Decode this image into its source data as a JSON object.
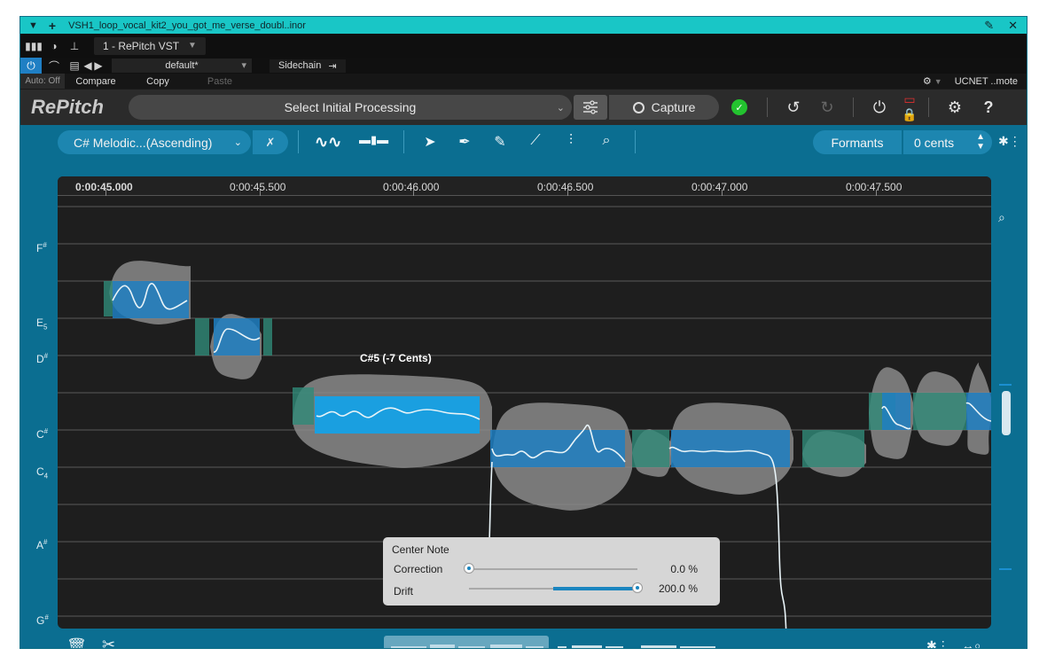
{
  "colors": {
    "title_bar": "#19c6c6",
    "editor_bg": "#0b6e91",
    "grid_bg": "#1e1e1e",
    "note_blue": "#1e7fc2",
    "note_selected": "#1a9fe0",
    "note_teal": "#2f8a78",
    "waveform": "#8a8a8a",
    "status_green": "#23c32f",
    "record_red": "#e03030"
  },
  "titlebar": {
    "menu_icon": "triangle-down-icon",
    "add_icon": "plus-icon",
    "title": "VSH1_loop_vocal_kit2_you_got_me_verse_doubl..inor",
    "pin_icon": "pin-icon",
    "close_icon": "close-icon"
  },
  "host": {
    "plugin_slot": "1 - RePitch VST",
    "preset": "default*",
    "sidechain_label": "Sidechain",
    "auto_off": "Auto: Off",
    "compare": "Compare",
    "copy": "Copy",
    "paste": "Paste",
    "remote": "UCNET ..mote"
  },
  "toolbar": {
    "logo": "RePitch",
    "processing": "Select Initial Processing",
    "capture": "Capture"
  },
  "modebar": {
    "scale": "C# Melodic...(Ascending)",
    "formants": "Formants",
    "cents": "0 cents"
  },
  "timeline": {
    "ticks": [
      "0:00:45.000",
      "0:00:45.500",
      "0:00:46.000",
      "0:00:46.500",
      "0:00:47.000",
      "0:00:47.500"
    ]
  },
  "note_axis": [
    {
      "name": "F",
      "mark": "#",
      "top": 0
    },
    {
      "name": "E",
      "sub": "5",
      "top": 0
    },
    {
      "name": "D",
      "mark": "#",
      "top": 0
    },
    {
      "name": "C",
      "mark": "#",
      "top": 0
    },
    {
      "name": "C",
      "sub": "4",
      "top": 0
    },
    {
      "name": "A",
      "mark": "#",
      "top": 0
    },
    {
      "name": "G",
      "mark": "#",
      "top": 0
    }
  ],
  "selected_note_label": "C#5 (-7 Cents)",
  "center_note": {
    "title": "Center Note",
    "correction_label": "Correction",
    "correction_value": "0.0 %",
    "correction_fraction": 0.0,
    "drift_label": "Drift",
    "drift_value": "200.0 %",
    "drift_fraction": 1.0
  }
}
